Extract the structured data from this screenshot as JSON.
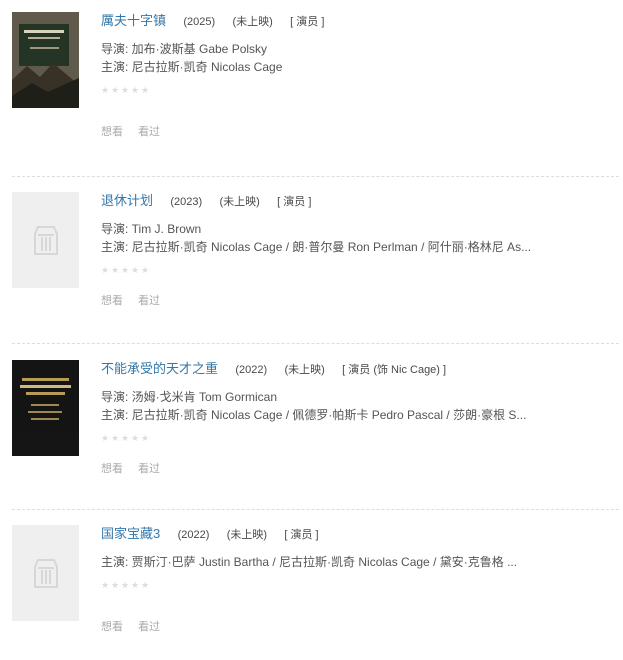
{
  "entries": [
    {
      "title": "厲夫十字镇",
      "year": "(2025)",
      "status": "(未上映)",
      "role": "[ 演员 ]",
      "director": "导演: 加布·波斯基 Gabe Polsky",
      "cast": "主演: 尼古拉斯·凯奇 Nicolas Cage",
      "wish": "想看",
      "seen": "看过"
    },
    {
      "title": "退休计划",
      "year": "(2023)",
      "status": "(未上映)",
      "role": "[ 演员 ]",
      "director": "导演: Tim J. Brown",
      "cast": "主演: 尼古拉斯·凯奇 Nicolas Cage / 朗·普尔曼 Ron Perlman / 阿什丽·格林尼 As...",
      "wish": "想看",
      "seen": "看过"
    },
    {
      "title": "不能承受的天才之重",
      "year": "(2022)",
      "status": "(未上映)",
      "role": "[ 演员 (饰 Nic Cage) ]",
      "director": "导演: 汤姆·戈米肯 Tom Gormican",
      "cast": "主演: 尼古拉斯·凯奇 Nicolas Cage / 佩德罗·帕斯卡 Pedro Pascal / 莎朗·豪根 S...",
      "wish": "想看",
      "seen": "看过"
    },
    {
      "title": "国家宝藏3",
      "year": "(2022)",
      "status": "(未上映)",
      "role": "[ 演员 ]",
      "cast": "主演: 贾斯汀·巴萨 Justin Bartha / 尼古拉斯·凯奇 Nicolas Cage / 黛安·克鲁格 ...",
      "wish": "想看",
      "seen": "看过"
    }
  ],
  "colors": {
    "link": "#3377aa",
    "text": "#494949",
    "muted": "#aaaaaa",
    "divider": "#dddddd"
  },
  "icons": {
    "rating": "star-icon",
    "placeholder": "poster-placeholder-icon"
  }
}
